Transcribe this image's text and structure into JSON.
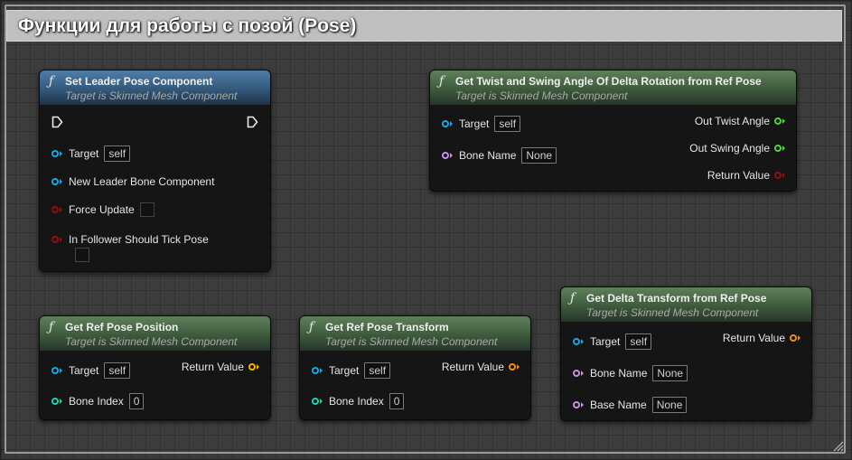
{
  "comment": {
    "title": "Функции для работы с позой (Pose)"
  },
  "nodes": {
    "set_leader": {
      "title": "Set Leader Pose Component",
      "subtitle": "Target is Skinned Mesh Component",
      "pins": {
        "target_label": "Target",
        "target_value": "self",
        "new_leader_label": "New Leader Bone Component",
        "force_update_label": "Force Update",
        "follower_tick_label": "In Follower Should Tick Pose"
      }
    },
    "twist_swing": {
      "title": "Get Twist and Swing Angle Of Delta Rotation from Ref Pose",
      "subtitle": "Target is Skinned Mesh Component",
      "pins": {
        "target_label": "Target",
        "target_value": "self",
        "bone_name_label": "Bone Name",
        "bone_name_value": "None",
        "out_twist_label": "Out Twist Angle",
        "out_swing_label": "Out Swing Angle",
        "return_label": "Return Value"
      }
    },
    "ref_pose_position": {
      "title": "Get Ref Pose Position",
      "subtitle": "Target is Skinned Mesh Component",
      "pins": {
        "target_label": "Target",
        "target_value": "self",
        "bone_index_label": "Bone Index",
        "bone_index_value": "0",
        "return_label": "Return Value"
      }
    },
    "ref_pose_transform": {
      "title": "Get Ref Pose Transform",
      "subtitle": "Target is Skinned Mesh Component",
      "pins": {
        "target_label": "Target",
        "target_value": "self",
        "bone_index_label": "Bone Index",
        "bone_index_value": "0",
        "return_label": "Return Value"
      }
    },
    "delta_transform": {
      "title": "Get Delta Transform from Ref Pose",
      "subtitle": "Target is Skinned Mesh Component",
      "pins": {
        "target_label": "Target",
        "target_value": "self",
        "bone_name_label": "Bone Name",
        "bone_name_value": "None",
        "base_name_label": "Base Name",
        "base_name_value": "None",
        "return_label": "Return Value"
      }
    }
  },
  "icons": {
    "function": "function-icon",
    "exec": "exec-pin-icon"
  },
  "colors": {
    "object_pin": "#1aa7e6",
    "name_pin": "#c691e0",
    "int_pin": "#1fd1a8",
    "bool_pin": "#8c1016",
    "float_pin": "#4fd33a",
    "transform_pin": "#f08c1c",
    "vector_pin": "#f2b600",
    "pure_header": "#4f6e4a",
    "impure_header": "#3c6a94"
  }
}
